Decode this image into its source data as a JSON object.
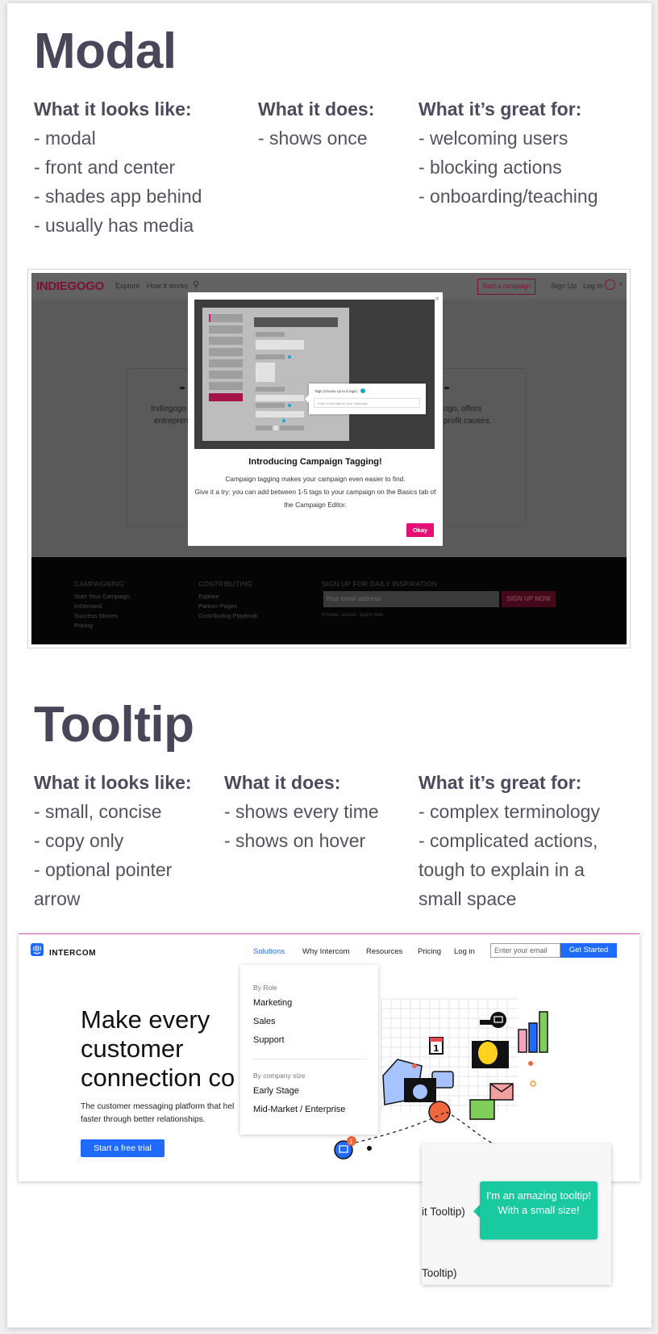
{
  "modal_section": {
    "title": "Modal",
    "looks_like": {
      "heading": "What it looks like:",
      "items": [
        "- modal",
        "- front and center",
        "- shades app behind",
        "- usually has media"
      ]
    },
    "does": {
      "heading": "What it does:",
      "items": [
        "- shows once"
      ]
    },
    "great_for": {
      "heading": "What it’s great for:",
      "items": [
        "- welcoming users",
        "- blocking actions",
        "- onboarding/teaching"
      ]
    }
  },
  "indiegogo": {
    "logo": "INDIEGOGO",
    "nav": [
      "Explore",
      "How it works"
    ],
    "start_campaign": "Start a campaign",
    "sign_up": "Sign Up",
    "log_in": "Log In",
    "bg_left": "Indiegogo h",
    "bg_left2": "entrepren",
    "bg_right": "ogo, offers",
    "bg_right2": "profit causes.",
    "modal": {
      "popup_label": "Tags (choose up to 5 tags)",
      "popup_placeholder": "Enter a few tags for your campaign",
      "title": "Introducing Campaign Tagging!",
      "line1": "Campaign tagging makes your campaign even easier to find.",
      "line2": "Give it a try: you can add between 1-5 tags to your campaign on the Basics tab of",
      "line3": "the Campaign Editor.",
      "okay": "Okay"
    },
    "footer": {
      "campaigning": {
        "heading": "CAMPAIGNING",
        "links": [
          "Start Your Campaign",
          "InDemand",
          "Success Stories",
          "Pricing"
        ]
      },
      "contributing": {
        "heading": "CONTRIBUTING",
        "links": [
          "Explore",
          "Partner Pages",
          "Contributing Playbook"
        ]
      },
      "signup": {
        "heading": "SIGN UP FOR DAILY INSPIRATION",
        "placeholder": "Your email address",
        "button": "SIGN UP NOW",
        "note": "Private, secure, spam-free"
      }
    }
  },
  "tooltip_section": {
    "title": "Tooltip",
    "looks_like": {
      "heading": "What it looks like:",
      "items": [
        "- small, concise",
        "- copy only",
        "- optional pointer",
        "arrow"
      ]
    },
    "does": {
      "heading": "What it does:",
      "items": [
        "- shows every time",
        "- shows on hover"
      ]
    },
    "great_for": {
      "heading": "What it’s great for:",
      "items": [
        "- complex terminology",
        "- complicated actions,",
        "tough to explain in a",
        "small space"
      ]
    }
  },
  "intercom": {
    "brand": "INTERCOM",
    "nav": {
      "solutions": "Solutions",
      "why": "Why Intercom",
      "resources": "Resources",
      "pricing": "Pricing",
      "login": "Log in"
    },
    "email_placeholder": "Enter your email",
    "get_started": "Get Started",
    "hero": [
      "Make every",
      "customer",
      "connection co"
    ],
    "sub": [
      "The customer messaging platform that hel",
      "faster through better relationships."
    ],
    "trial": "Start a free trial",
    "dropdown": {
      "by_role": "By Role",
      "role_items": [
        "Marketing",
        "Sales",
        "Support"
      ],
      "by_size": "By company size",
      "size_items": [
        "Early Stage",
        "Mid-Market / Enterprise"
      ]
    },
    "badge_count": "1",
    "calendar_day": "1"
  },
  "tooltip_demo": {
    "line_top": "it Tooltip)",
    "line_bottom": "Tooltip)",
    "bubble": "I'm an amazing tooltip! With a small size!"
  },
  "colors": {
    "heading": "#4a4558",
    "indiegogo_pink": "#e51075",
    "intercom_blue": "#1f6bff",
    "tooltip_green": "#19c9a0"
  }
}
